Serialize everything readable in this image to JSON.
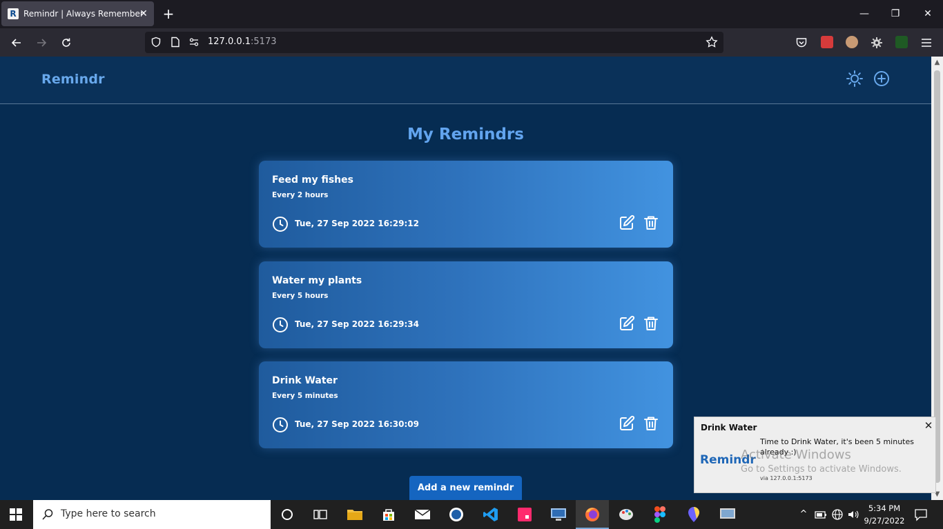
{
  "browser": {
    "tab_title": "Remindr | Always Remember",
    "favicon_letter": "R",
    "tab_close": "✕",
    "new_tab": "+",
    "url_host": "127.0.0.1",
    "url_port": ":5173",
    "window_controls": {
      "minimize": "—",
      "maximize": "❐",
      "close": "✕"
    }
  },
  "app": {
    "logo": "Remindr",
    "page_title": "My Remindrs",
    "add_button": "Add a new remindr",
    "reminders": [
      {
        "title": "Feed my fishes",
        "frequency": "Every 2 hours",
        "time": "Tue, 27 Sep 2022 16:29:12"
      },
      {
        "title": "Water my plants",
        "frequency": "Every 5 hours",
        "time": "Tue, 27 Sep 2022 16:29:34"
      },
      {
        "title": "Drink Water",
        "frequency": "Every 5 minutes",
        "time": "Tue, 27 Sep 2022 16:30:09"
      }
    ]
  },
  "notification": {
    "title": "Drink Water",
    "close": "✕",
    "logo": "Remindr",
    "body": "Time to Drink Water, it's been 5 minutes already :)",
    "source": "via 127.0.0.1:5173"
  },
  "watermark": {
    "line1": "Activate Windows",
    "line2": "Go to Settings to activate Windows."
  },
  "taskbar": {
    "search_placeholder": "Type here to search",
    "time": "5:34 PM",
    "date": "9/27/2022"
  },
  "colors": {
    "page_bg": "#062c52",
    "accent": "#62a4ee",
    "card_from": "#1f5b9d",
    "card_to": "#4293e0",
    "button": "#1565c0"
  }
}
